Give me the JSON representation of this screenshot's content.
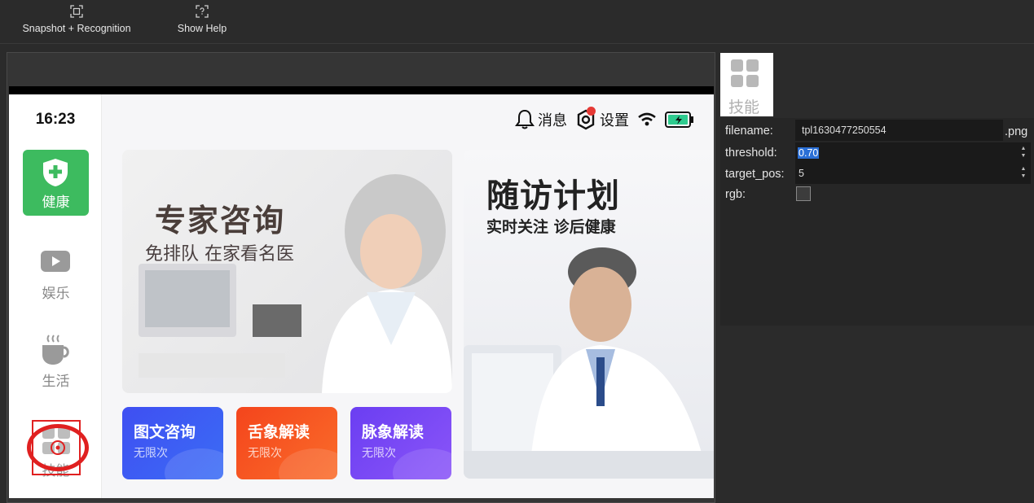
{
  "toolbar": {
    "snapshot_label": "Snapshot + Recognition",
    "help_label": "Show Help"
  },
  "device": {
    "time": "16:23",
    "nav": {
      "health": "健康",
      "entertainment": "娱乐",
      "life": "生活",
      "skills": "技能"
    },
    "status": {
      "messages": "消息",
      "settings": "设置"
    },
    "cards": {
      "consult_title": "专家咨询",
      "consult_sub": "免排队 在家看名医",
      "follow_title": "随访计划",
      "follow_sub": "实时关注 诊后健康",
      "mini": [
        {
          "title": "图文咨询",
          "sub": "无限次"
        },
        {
          "title": "舌象解读",
          "sub": "无限次"
        },
        {
          "title": "脉象解读",
          "sub": "无限次"
        }
      ]
    }
  },
  "skill_tab": {
    "label": "技能"
  },
  "properties": {
    "filename_label": "filename:",
    "filename_value": "tpl1630477250554",
    "filename_ext": ".png",
    "threshold_label": "threshold:",
    "threshold_value": "0.70",
    "target_pos_label": "target_pos:",
    "target_pos_value": "5",
    "rgb_label": "rgb:",
    "rgb_checked": false
  },
  "colors": {
    "accent_green": "#3dbb5f",
    "marker_red": "#e02020",
    "selection_blue": "#2a6fd6"
  }
}
